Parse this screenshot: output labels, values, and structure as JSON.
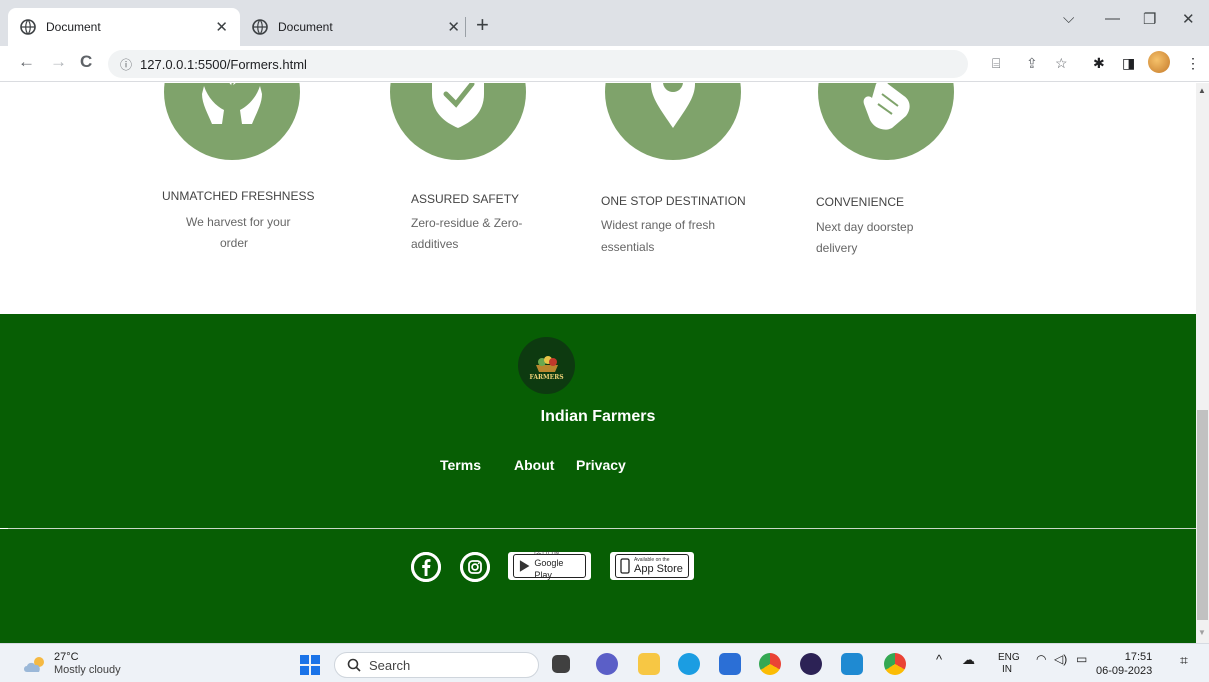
{
  "browser": {
    "tabs": [
      {
        "title": "Document",
        "active": true
      },
      {
        "title": "Document",
        "active": false
      }
    ],
    "new_tab": "+",
    "url": "127.0.0.1:5500/Formers.html"
  },
  "features": [
    {
      "title": "UNMATCHED FRESHNESS",
      "desc_line1": "We harvest for your",
      "desc_line2": "order",
      "icon": "leaf-in-hands-icon"
    },
    {
      "title": "ASSURED SAFETY",
      "desc_line1": "Zero-residue & Zero-",
      "desc_line2": "additives",
      "icon": "shield-check-icon"
    },
    {
      "title": "ONE STOP DESTINATION",
      "desc_line1": "Widest range of fresh",
      "desc_line2": "essentials",
      "icon": "map-pin-icon"
    },
    {
      "title": "CONVENIENCE",
      "desc_line1": "Next day doorstep",
      "desc_line2": "delivery",
      "icon": "tap-hand-icon"
    }
  ],
  "footer": {
    "logo_text": "FARMERS",
    "brand": "Indian Farmers",
    "links": [
      "Terms",
      "About",
      "Privacy"
    ],
    "google_play": {
      "small": "GET IT ON",
      "big": "Google Play"
    },
    "app_store": {
      "small": "Available on the",
      "big": "App Store"
    }
  },
  "taskbar": {
    "weather_temp": "27°C",
    "weather_cond": "Mostly cloudy",
    "search": "Search",
    "lang1": "ENG",
    "lang2": "IN",
    "time": "17:51",
    "date": "06-09-2023"
  },
  "colors": {
    "feature_green": "#7fa36b",
    "footer_green": "#075e04"
  }
}
